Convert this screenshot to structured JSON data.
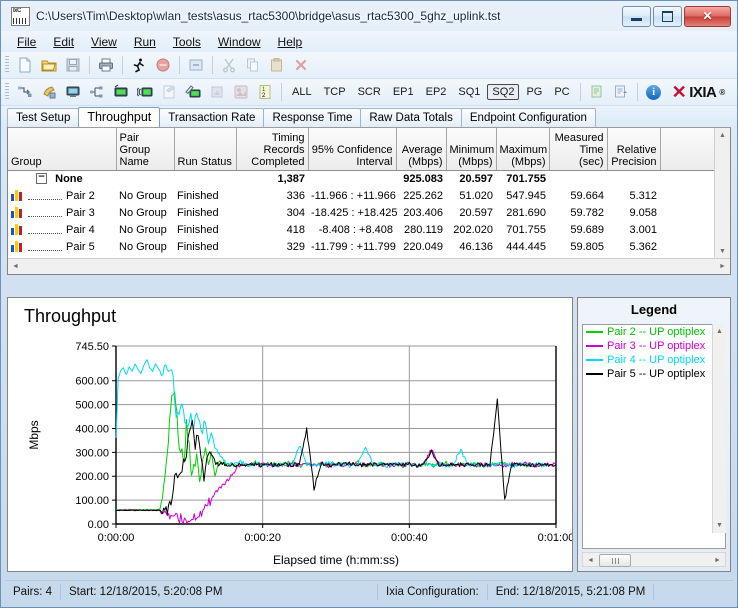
{
  "window": {
    "title": "C:\\Users\\Tim\\Desktop\\wlan_tests\\asus_rtac5300\\bridge\\asus_rtac5300_5ghz_uplink.tst",
    "app_icon": "ixchariot-icon",
    "minimize_label": "Minimize",
    "maximize_label": "Maximize",
    "close_label": "✕"
  },
  "menu": [
    {
      "label": "File"
    },
    {
      "label": "Edit"
    },
    {
      "label": "View"
    },
    {
      "label": "Run"
    },
    {
      "label": "Tools"
    },
    {
      "label": "Window"
    },
    {
      "label": "Help"
    }
  ],
  "toolbar_row1": [
    {
      "name": "new-icon",
      "glyph": "page"
    },
    {
      "name": "open-folder-icon",
      "glyph": "folder"
    },
    {
      "name": "save-icon",
      "glyph": "save"
    },
    {
      "name": "separator",
      "glyph": "sep"
    },
    {
      "name": "print-icon",
      "glyph": "printer"
    },
    {
      "name": "separator",
      "glyph": "sep"
    },
    {
      "name": "run-icon",
      "glyph": "runner"
    },
    {
      "name": "stop-icon",
      "glyph": "stop"
    },
    {
      "name": "separator",
      "glyph": "sep"
    },
    {
      "name": "refresh-icon",
      "glyph": "refresh"
    },
    {
      "name": "separator",
      "glyph": "sep"
    },
    {
      "name": "cut-icon",
      "glyph": "scissors"
    },
    {
      "name": "copy-icon",
      "glyph": "copy"
    },
    {
      "name": "paste-icon",
      "glyph": "paste"
    },
    {
      "name": "delete-icon",
      "glyph": "delete"
    }
  ],
  "toolbar_row2": [
    {
      "name": "add-pair-icon",
      "glyph": "arrow-pair"
    },
    {
      "name": "add-multicast-pair-icon",
      "glyph": "phone-pair"
    },
    {
      "name": "add-endpoint-icon",
      "glyph": "monitor"
    },
    {
      "name": "add-group-icon",
      "glyph": "network"
    },
    {
      "name": "add-video-pair-icon",
      "glyph": "monitor-green"
    },
    {
      "name": "add-voip-pair-icon",
      "glyph": "monitor-wave"
    },
    {
      "name": "edit-pair-icon",
      "glyph": "edit"
    },
    {
      "name": "edit-script-icon",
      "glyph": "pencil-monitor"
    },
    {
      "name": "copy-pair-icon",
      "glyph": "copy-dim"
    },
    {
      "name": "swap-endpoints-icon",
      "glyph": "swap-dim"
    },
    {
      "name": "renumber-pairs-icon",
      "glyph": "numbers"
    }
  ],
  "toolbar_filters": {
    "items": [
      {
        "label": "ALL",
        "pressed": false
      },
      {
        "label": "TCP",
        "pressed": false
      },
      {
        "label": "SCR",
        "pressed": false
      },
      {
        "label": "EP1",
        "pressed": false
      },
      {
        "label": "EP2",
        "pressed": false
      },
      {
        "label": "SQ1",
        "pressed": false
      },
      {
        "label": "SQ2",
        "pressed": true
      },
      {
        "label": "PG",
        "pressed": false
      },
      {
        "label": "PC",
        "pressed": false
      }
    ]
  },
  "toolbar_right": {
    "export_icon": "export-icon",
    "report_icon": "report-icon",
    "info_icon": "info-icon",
    "info_glyph": "i",
    "brand_x": "✕",
    "brand_name": "IXIA",
    "brand_tm": "®"
  },
  "tabs": [
    {
      "label": "Test Setup",
      "active": false
    },
    {
      "label": "Throughput",
      "active": true
    },
    {
      "label": "Transaction Rate",
      "active": false
    },
    {
      "label": "Response Time",
      "active": false
    },
    {
      "label": "Raw Data Totals",
      "active": false
    },
    {
      "label": "Endpoint Configuration",
      "active": false
    }
  ],
  "grid": {
    "columns": [
      {
        "label": "Group",
        "align": "left"
      },
      {
        "label": "Pair Group\nName",
        "align": "left"
      },
      {
        "label": "Run Status",
        "align": "left"
      },
      {
        "label": "Timing Records\nCompleted",
        "align": "right"
      },
      {
        "label": "95% Confidence\nInterval",
        "align": "right"
      },
      {
        "label": "Average\n(Mbps)",
        "align": "right"
      },
      {
        "label": "Minimum\n(Mbps)",
        "align": "right"
      },
      {
        "label": "Maximum\n(Mbps)",
        "align": "right"
      },
      {
        "label": "Measured\nTime (sec)",
        "align": "right"
      },
      {
        "label": "Relative\nPrecision",
        "align": "right"
      }
    ],
    "column_headers_flat": [
      "Group",
      "Pair Group Name",
      "Run Status",
      "Timing Records Completed",
      "95% Confidence Interval",
      "Average (Mbps)",
      "Minimum (Mbps)",
      "Maximum (Mbps)",
      "Measured Time (sec)",
      "Relative Precision"
    ],
    "group_row": {
      "expander": "−",
      "name": "None",
      "timing_records": "1,387",
      "average": "925.083",
      "minimum": "20.597",
      "maximum": "701.755",
      "measured_time": "",
      "relative_precision": "",
      "confidence": ""
    },
    "rows": [
      {
        "icon": "pair-chart-icon",
        "pair": "Pair 2",
        "group_name": "No Group",
        "run_status": "Finished",
        "timing_records": "336",
        "confidence": "-11.966 : +11.966",
        "average": "225.262",
        "minimum": "51.020",
        "maximum": "547.945",
        "measured_time": "59.664",
        "relative_precision": "5.312"
      },
      {
        "icon": "pair-chart-icon",
        "pair": "Pair 3",
        "group_name": "No Group",
        "run_status": "Finished",
        "timing_records": "304",
        "confidence": "-18.425 : +18.425",
        "average": "203.406",
        "minimum": "20.597",
        "maximum": "281.690",
        "measured_time": "59.782",
        "relative_precision": "9.058"
      },
      {
        "icon": "pair-chart-icon",
        "pair": "Pair 4",
        "group_name": "No Group",
        "run_status": "Finished",
        "timing_records": "418",
        "confidence": "-8.408 : +8.408",
        "average": "280.119",
        "minimum": "202.020",
        "maximum": "701.755",
        "measured_time": "59.689",
        "relative_precision": "3.001"
      },
      {
        "icon": "pair-chart-icon",
        "pair": "Pair 5",
        "group_name": "No Group",
        "run_status": "Finished",
        "timing_records": "329",
        "confidence": "-11.799 : +11.799",
        "average": "220.049",
        "minimum": "46.136",
        "maximum": "444.445",
        "measured_time": "59.805",
        "relative_precision": "5.362"
      }
    ]
  },
  "legend": {
    "title": "Legend",
    "items": [
      {
        "label": "Pair 2 -- UP optiplex",
        "color": "#00d000"
      },
      {
        "label": "Pair 3 -- UP optiplex",
        "color": "#cc00cc"
      },
      {
        "label": "Pair 4 -- UP optiplex",
        "color": "#00d8f0"
      },
      {
        "label": "Pair 5 -- UP optiplex",
        "color": "#000000"
      }
    ]
  },
  "statusbar": {
    "pairs": "Pairs: 4",
    "start": "Start: 12/18/2015, 5:20:08 PM",
    "config": "Ixia Configuration:",
    "end": "End: 12/18/2015, 5:21:08 PM"
  },
  "chart_data": {
    "type": "line",
    "title": "Throughput",
    "xlabel": "Elapsed time (h:mm:ss)",
    "ylabel": "Mbps",
    "grid": true,
    "legend_position": "right-panel",
    "ylim": [
      0,
      745.5
    ],
    "yticks": [
      0.0,
      100.0,
      200.0,
      300.0,
      400.0,
      500.0,
      600.0,
      745.5
    ],
    "ytick_labels": [
      "0.00",
      "100.00",
      "200.00",
      "300.00",
      "400.00",
      "500.00",
      "600.00",
      "745.50"
    ],
    "xlim_seconds": [
      0,
      60
    ],
    "xticks_seconds": [
      0,
      20,
      40,
      60
    ],
    "xtick_labels": [
      "0:00:00",
      "0:00:20",
      "0:00:40",
      "0:01:00"
    ],
    "series": [
      {
        "name": "Pair 2 -- UP optiplex",
        "color": "#00d000",
        "x": [
          0,
          1,
          2,
          3,
          4,
          5,
          6,
          6.5,
          7,
          7.3,
          7.6,
          8,
          8.3,
          8.6,
          9,
          9.3,
          9.6,
          10,
          10.3,
          10.6,
          11,
          11.4,
          11.8,
          12.2,
          12.6,
          13,
          13.5,
          14,
          15,
          16,
          17,
          18,
          19,
          20,
          21,
          22,
          23,
          24,
          25,
          26,
          27,
          28,
          29,
          30,
          31,
          32,
          33,
          34,
          35,
          36,
          37,
          38,
          39,
          40,
          41,
          42,
          43,
          44,
          45,
          46,
          47,
          48,
          49,
          50,
          51,
          52,
          53,
          54,
          55,
          56,
          57,
          58,
          59,
          60
        ],
        "y": [
          60,
          60,
          60,
          60,
          60,
          60,
          62,
          150,
          300,
          420,
          520,
          548,
          470,
          330,
          300,
          270,
          420,
          330,
          190,
          240,
          280,
          170,
          250,
          300,
          260,
          300,
          200,
          258,
          250,
          245,
          252,
          243,
          256,
          247,
          253,
          244,
          250,
          262,
          242,
          255,
          247,
          251,
          243,
          253,
          246,
          250,
          258,
          244,
          249,
          252,
          246,
          254,
          243,
          250,
          247,
          252,
          245,
          249,
          256,
          243,
          250,
          247,
          253,
          244,
          251,
          248,
          254,
          243,
          250,
          246,
          252,
          247,
          250
        ]
      },
      {
        "name": "Pair 3 -- UP optiplex",
        "color": "#cc00cc",
        "x": [
          0,
          1,
          2,
          3,
          4,
          5,
          6,
          7,
          8,
          9,
          10,
          11,
          12,
          13,
          14,
          15,
          16,
          17,
          18,
          19,
          20,
          21,
          22,
          23,
          24,
          25,
          26,
          27,
          28,
          29,
          30,
          31,
          32,
          33,
          34,
          35,
          36,
          37,
          38,
          39,
          40,
          41,
          42,
          43,
          44,
          45,
          46,
          47,
          48,
          49,
          50,
          51,
          52,
          53,
          54,
          55,
          56,
          57,
          58,
          59,
          60
        ],
        "y": [
          58,
          58,
          58,
          58,
          58,
          58,
          56,
          30,
          24,
          22,
          22,
          30,
          60,
          105,
          148,
          175,
          218,
          248,
          252,
          246,
          250,
          244,
          252,
          247,
          250,
          245,
          251,
          248,
          253,
          244,
          250,
          247,
          252,
          245,
          250,
          248,
          253,
          244,
          250,
          247,
          251,
          246,
          252,
          310,
          252,
          245,
          250,
          247,
          253,
          244,
          250,
          247,
          252,
          246,
          250,
          248,
          252,
          245,
          250,
          247,
          250
        ]
      },
      {
        "name": "Pair 4 -- UP optiplex",
        "color": "#00d8f0",
        "x": [
          0,
          0.3,
          0.6,
          1,
          1.4,
          1.8,
          2.2,
          2.6,
          3,
          3.4,
          3.8,
          4.2,
          4.6,
          5,
          5.4,
          5.8,
          6.2,
          6.6,
          7,
          7.4,
          7.8,
          8.2,
          8.6,
          9,
          9.4,
          9.8,
          10.2,
          10.6,
          11,
          11.4,
          11.8,
          12.2,
          12.6,
          13,
          13.6,
          14.2,
          15,
          16,
          17,
          18,
          19,
          20,
          21,
          22,
          23,
          24,
          25,
          26,
          27,
          28,
          29,
          30,
          31,
          32,
          33,
          34,
          35,
          36,
          37,
          38,
          39,
          40,
          41,
          42,
          43,
          44,
          45,
          46,
          47,
          48,
          49,
          50,
          51,
          52,
          53,
          54,
          55,
          56,
          57,
          58,
          59,
          60
        ],
        "y": [
          360,
          610,
          640,
          655,
          625,
          660,
          640,
          670,
          648,
          630,
          665,
          690,
          655,
          640,
          672,
          650,
          630,
          665,
          645,
          660,
          640,
          430,
          470,
          520,
          440,
          390,
          460,
          410,
          480,
          420,
          390,
          430,
          350,
          380,
          310,
          290,
          255,
          248,
          258,
          244,
          252,
          246,
          256,
          243,
          250,
          248,
          330,
          252,
          245,
          250,
          260,
          246,
          252,
          244,
          250,
          330,
          248,
          252,
          245,
          251,
          247,
          253,
          244,
          250,
          248,
          252,
          246,
          250,
          310,
          247,
          252,
          245,
          250,
          248,
          253,
          244,
          250,
          247,
          252,
          246,
          250
        ]
      },
      {
        "name": "Pair 5 -- UP optiplex",
        "color": "#000000",
        "x": [
          0,
          1,
          2,
          3,
          4,
          5,
          6,
          7,
          7.5,
          8,
          8.4,
          8.8,
          9.2,
          9.6,
          10,
          10.4,
          10.8,
          11.2,
          11.6,
          12,
          12.4,
          12.8,
          13.2,
          13.6,
          14,
          15,
          16,
          17,
          18,
          19,
          20,
          21,
          22,
          23,
          24,
          25,
          26,
          27,
          28,
          29,
          30,
          31,
          32,
          33,
          34,
          35,
          36,
          37,
          38,
          39,
          40,
          41,
          42,
          43,
          44,
          45,
          46,
          47,
          48,
          49,
          50,
          51,
          52,
          53,
          54,
          55,
          56,
          57,
          58,
          59,
          60
        ],
        "y": [
          57,
          57,
          57,
          57,
          57,
          57,
          58,
          62,
          95,
          190,
          200,
          215,
          265,
          300,
          390,
          445,
          330,
          380,
          300,
          190,
          290,
          320,
          290,
          255,
          250,
          252,
          245,
          250,
          248,
          253,
          244,
          250,
          247,
          252,
          246,
          250,
          400,
          150,
          252,
          245,
          250,
          247,
          253,
          244,
          250,
          248,
          252,
          245,
          250,
          247,
          252,
          246,
          250,
          310,
          248,
          252,
          245,
          250,
          247,
          252,
          246,
          250,
          520,
          100,
          250,
          247,
          252,
          245,
          250,
          248,
          250
        ]
      }
    ]
  }
}
